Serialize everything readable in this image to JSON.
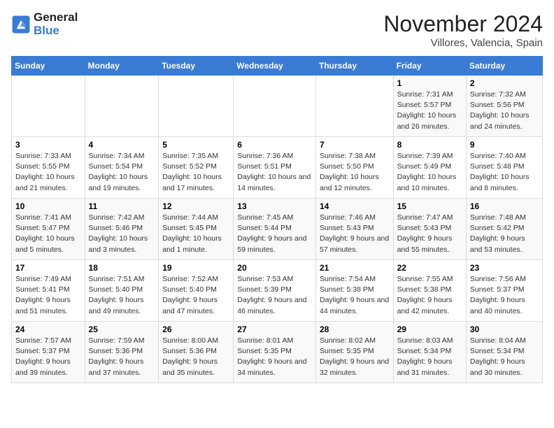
{
  "logo": {
    "line1": "General",
    "line2": "Blue"
  },
  "title": "November 2024",
  "location": "Villores, Valencia, Spain",
  "days_of_week": [
    "Sunday",
    "Monday",
    "Tuesday",
    "Wednesday",
    "Thursday",
    "Friday",
    "Saturday"
  ],
  "weeks": [
    [
      {
        "day": "",
        "info": ""
      },
      {
        "day": "",
        "info": ""
      },
      {
        "day": "",
        "info": ""
      },
      {
        "day": "",
        "info": ""
      },
      {
        "day": "",
        "info": ""
      },
      {
        "day": "1",
        "info": "Sunrise: 7:31 AM\nSunset: 5:57 PM\nDaylight: 10 hours and 26 minutes."
      },
      {
        "day": "2",
        "info": "Sunrise: 7:32 AM\nSunset: 5:56 PM\nDaylight: 10 hours and 24 minutes."
      }
    ],
    [
      {
        "day": "3",
        "info": "Sunrise: 7:33 AM\nSunset: 5:55 PM\nDaylight: 10 hours and 21 minutes."
      },
      {
        "day": "4",
        "info": "Sunrise: 7:34 AM\nSunset: 5:54 PM\nDaylight: 10 hours and 19 minutes."
      },
      {
        "day": "5",
        "info": "Sunrise: 7:35 AM\nSunset: 5:52 PM\nDaylight: 10 hours and 17 minutes."
      },
      {
        "day": "6",
        "info": "Sunrise: 7:36 AM\nSunset: 5:51 PM\nDaylight: 10 hours and 14 minutes."
      },
      {
        "day": "7",
        "info": "Sunrise: 7:38 AM\nSunset: 5:50 PM\nDaylight: 10 hours and 12 minutes."
      },
      {
        "day": "8",
        "info": "Sunrise: 7:39 AM\nSunset: 5:49 PM\nDaylight: 10 hours and 10 minutes."
      },
      {
        "day": "9",
        "info": "Sunrise: 7:40 AM\nSunset: 5:48 PM\nDaylight: 10 hours and 8 minutes."
      }
    ],
    [
      {
        "day": "10",
        "info": "Sunrise: 7:41 AM\nSunset: 5:47 PM\nDaylight: 10 hours and 5 minutes."
      },
      {
        "day": "11",
        "info": "Sunrise: 7:42 AM\nSunset: 5:46 PM\nDaylight: 10 hours and 3 minutes."
      },
      {
        "day": "12",
        "info": "Sunrise: 7:44 AM\nSunset: 5:45 PM\nDaylight: 10 hours and 1 minute."
      },
      {
        "day": "13",
        "info": "Sunrise: 7:45 AM\nSunset: 5:44 PM\nDaylight: 9 hours and 59 minutes."
      },
      {
        "day": "14",
        "info": "Sunrise: 7:46 AM\nSunset: 5:43 PM\nDaylight: 9 hours and 57 minutes."
      },
      {
        "day": "15",
        "info": "Sunrise: 7:47 AM\nSunset: 5:43 PM\nDaylight: 9 hours and 55 minutes."
      },
      {
        "day": "16",
        "info": "Sunrise: 7:48 AM\nSunset: 5:42 PM\nDaylight: 9 hours and 53 minutes."
      }
    ],
    [
      {
        "day": "17",
        "info": "Sunrise: 7:49 AM\nSunset: 5:41 PM\nDaylight: 9 hours and 51 minutes."
      },
      {
        "day": "18",
        "info": "Sunrise: 7:51 AM\nSunset: 5:40 PM\nDaylight: 9 hours and 49 minutes."
      },
      {
        "day": "19",
        "info": "Sunrise: 7:52 AM\nSunset: 5:40 PM\nDaylight: 9 hours and 47 minutes."
      },
      {
        "day": "20",
        "info": "Sunrise: 7:53 AM\nSunset: 5:39 PM\nDaylight: 9 hours and 46 minutes."
      },
      {
        "day": "21",
        "info": "Sunrise: 7:54 AM\nSunset: 5:38 PM\nDaylight: 9 hours and 44 minutes."
      },
      {
        "day": "22",
        "info": "Sunrise: 7:55 AM\nSunset: 5:38 PM\nDaylight: 9 hours and 42 minutes."
      },
      {
        "day": "23",
        "info": "Sunrise: 7:56 AM\nSunset: 5:37 PM\nDaylight: 9 hours and 40 minutes."
      }
    ],
    [
      {
        "day": "24",
        "info": "Sunrise: 7:57 AM\nSunset: 5:37 PM\nDaylight: 9 hours and 39 minutes."
      },
      {
        "day": "25",
        "info": "Sunrise: 7:59 AM\nSunset: 5:36 PM\nDaylight: 9 hours and 37 minutes."
      },
      {
        "day": "26",
        "info": "Sunrise: 8:00 AM\nSunset: 5:36 PM\nDaylight: 9 hours and 35 minutes."
      },
      {
        "day": "27",
        "info": "Sunrise: 8:01 AM\nSunset: 5:35 PM\nDaylight: 9 hours and 34 minutes."
      },
      {
        "day": "28",
        "info": "Sunrise: 8:02 AM\nSunset: 5:35 PM\nDaylight: 9 hours and 32 minutes."
      },
      {
        "day": "29",
        "info": "Sunrise: 8:03 AM\nSunset: 5:34 PM\nDaylight: 9 hours and 31 minutes."
      },
      {
        "day": "30",
        "info": "Sunrise: 8:04 AM\nSunset: 5:34 PM\nDaylight: 9 hours and 30 minutes."
      }
    ]
  ]
}
